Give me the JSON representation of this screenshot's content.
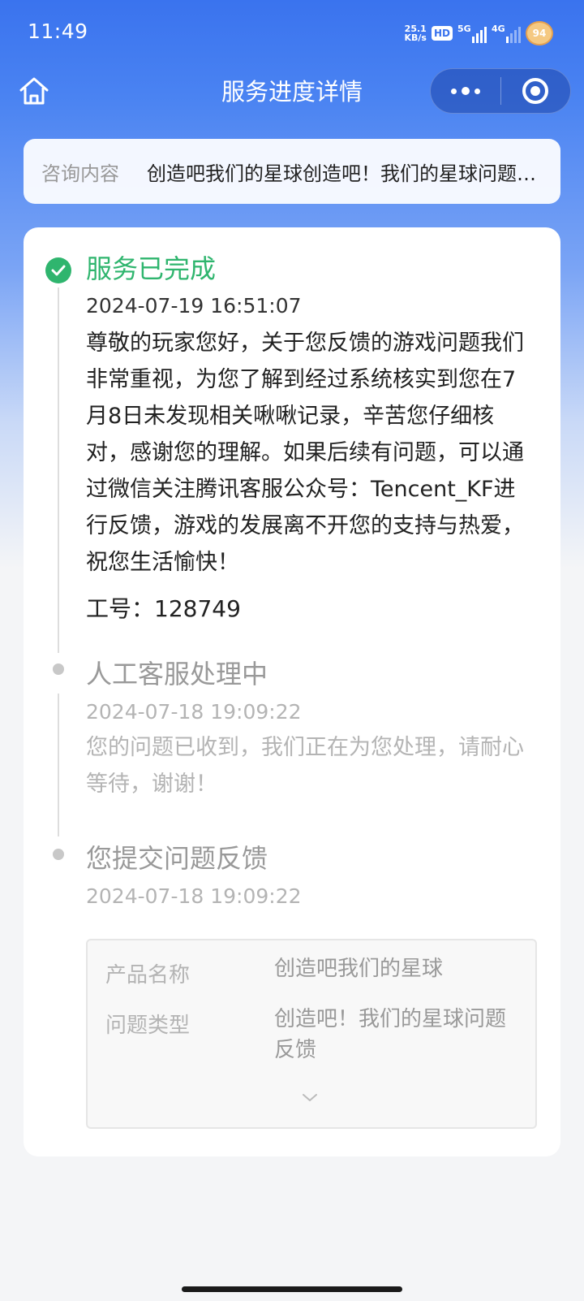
{
  "status_bar": {
    "time": "11:49",
    "net_speed_value": "25.1",
    "net_speed_unit": "KB/s",
    "hd": "HD",
    "sig1": "5G",
    "sig2": "4G",
    "battery": "94"
  },
  "nav": {
    "title": "服务进度详情"
  },
  "consult": {
    "label": "咨询内容",
    "text": "创造吧我们的星球创造吧！我们的星球问题反馈"
  },
  "timeline": {
    "steps": [
      {
        "title": "服务已完成",
        "time": "2024-07-19 16:51:07",
        "body": "尊敬的玩家您好，关于您反馈的游戏问题我们非常重视，为您了解到经过系统核实到您在7月8日未发现相关啾啾记录，辛苦您仔细核对，感谢您的理解。如果后续有问题，可以通过微信关注腾讯客服公众号：Tencent_KF进行反馈，游戏的发展离不开您的支持与热爱，祝您生活愉快！",
        "staff_id": "工号：128749"
      },
      {
        "title": "人工客服处理中",
        "time": "2024-07-18 19:09:22",
        "body": "您的问题已收到，我们正在为您处理，请耐心等待，谢谢！"
      },
      {
        "title": "您提交问题反馈",
        "time": "2024-07-18 19:09:22"
      }
    ],
    "details": {
      "product_key": "产品名称",
      "product_val": "创造吧我们的星球",
      "type_key": "问题类型",
      "type_val": "创造吧！我们的星球问题反馈"
    }
  },
  "colors": {
    "brand_blue": "#3a73ee",
    "done_green": "#2fb56e"
  },
  "icons": [
    "home-icon",
    "more-icon",
    "target-icon",
    "check-circle-icon",
    "chevron-down-icon"
  ]
}
